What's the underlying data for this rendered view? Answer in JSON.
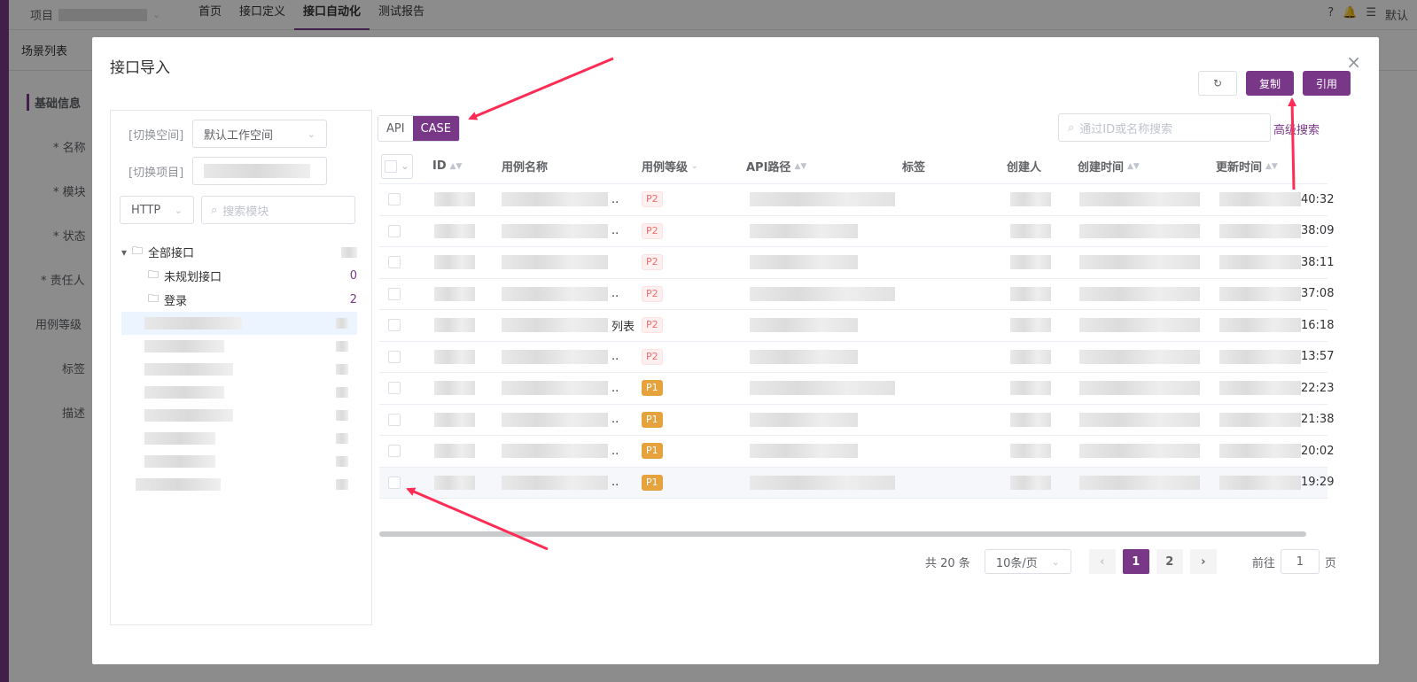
{
  "background": {
    "project_label": "项目",
    "nav": [
      "首页",
      "接口定义",
      "接口自动化",
      "测试报告"
    ],
    "nav_active": 2,
    "top_right": "默认",
    "sub_tab": "场景列表",
    "section_title": "基础信息",
    "form_labels": [
      "* 名称",
      "* 模块",
      "* 状态",
      "* 责任人",
      "用例等级",
      "标签",
      "描述"
    ]
  },
  "dialog": {
    "title": "接口导入",
    "close_icon": "×",
    "refresh_icon": "↻",
    "copy_label": "复制",
    "reference_label": "引用"
  },
  "left_panel": {
    "workspace_label": "[切换空间]",
    "workspace_value": "默认工作空间",
    "project_label": "[切换项目]",
    "protocol_value": "HTTP",
    "module_search_placeholder": "搜索模块",
    "tree": {
      "root": "全部接口",
      "children": [
        {
          "label": "未规划接口",
          "count": "0"
        },
        {
          "label": "登录",
          "count": "2"
        }
      ]
    }
  },
  "right_panel": {
    "seg_api": "API",
    "seg_case": "CASE",
    "search_placeholder": "通过ID或名称搜索",
    "advanced_search": "高级搜索",
    "columns": [
      "ID",
      "用例名称",
      "用例等级",
      "API路径",
      "标签",
      "创建人",
      "创建时间",
      "更新时间"
    ],
    "rows": [
      {
        "name_tail": "..",
        "level": "P2",
        "time_tail": "40:32"
      },
      {
        "name_tail": "..",
        "level": "P2",
        "time_tail": "38:09"
      },
      {
        "name_tail": "",
        "level": "P2",
        "time_tail": "38:11"
      },
      {
        "name_tail": "..",
        "level": "P2",
        "time_tail": "37:08"
      },
      {
        "name_tail": "列表",
        "level": "P2",
        "time_tail": "16:18"
      },
      {
        "name_tail": "..",
        "level": "P2",
        "time_tail": "13:57"
      },
      {
        "name_tail": "..",
        "level": "P1",
        "time_tail": "22:23"
      },
      {
        "name_tail": "..",
        "level": "P1",
        "time_tail": "21:38"
      },
      {
        "name_tail": "..",
        "level": "P1",
        "time_tail": "20:02"
      },
      {
        "name_tail": "..",
        "level": "P1",
        "time_tail": "19:29"
      }
    ],
    "pagination": {
      "total": "共 20 条",
      "page_size": "10条/页",
      "pages": [
        "1",
        "2"
      ],
      "current": "1",
      "goto_label": "前往",
      "goto_value": "1",
      "page_suffix": "页"
    }
  },
  "colors": {
    "accent": "#783887",
    "arrow": "#ff2d55",
    "p1": "#e6a23c",
    "p2": "#f56c6c"
  }
}
